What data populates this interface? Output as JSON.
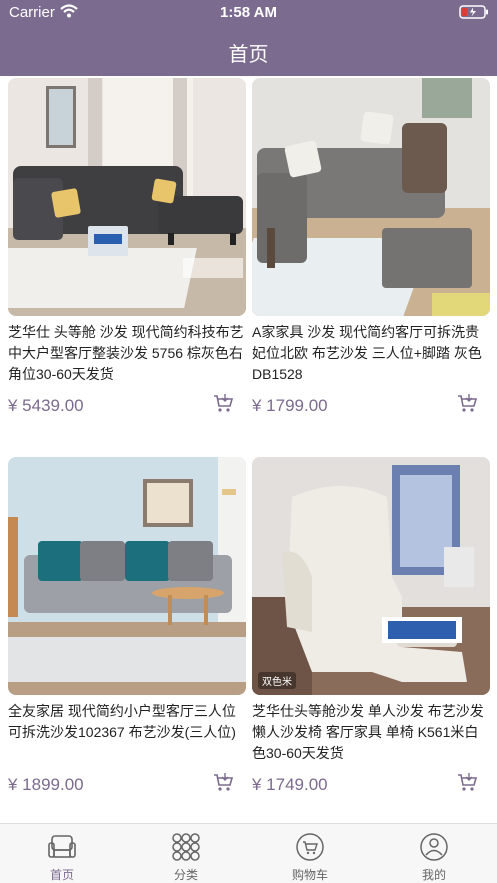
{
  "status_bar": {
    "carrier": "Carrier",
    "time": "1:58 AM"
  },
  "header": {
    "title": "首页"
  },
  "colors": {
    "accent": "#7b6b8f",
    "price": "#7b6b8f",
    "tab_active": "#7b6b8f",
    "tab_inactive": "#666666"
  },
  "products": [
    {
      "name": "芝华仕 头等舱 沙发 现代简约科技布艺中大户型客厅整装沙发 5756 棕灰色右角位30-60天发货",
      "price": "¥ 5439.00",
      "cart_icon": "cart-icon"
    },
    {
      "name": "A家家具 沙发 现代简约客厅可拆洗贵妃位北欧 布艺沙发 三人位+脚踏 灰色 DB1528",
      "price": "¥ 1799.00",
      "cart_icon": "cart-icon"
    },
    {
      "name": "全友家居 现代简约小户型客厅三人位可拆洗沙发102367 布艺沙发(三人位)",
      "price": "¥ 1899.00",
      "cart_icon": "cart-icon"
    },
    {
      "name": "芝华仕头等舱沙发 单人沙发 布艺沙发 懒人沙发椅 客厅家具 单椅 K561米白色30-60天发货",
      "price": "¥ 1749.00",
      "cart_icon": "cart-icon",
      "image_tag": "双色米"
    }
  ],
  "tabs": [
    {
      "label": "首页",
      "icon": "sofa-icon",
      "active": true
    },
    {
      "label": "分类",
      "icon": "grid-icon",
      "active": false
    },
    {
      "label": "购物车",
      "icon": "cart-icon",
      "active": false
    },
    {
      "label": "我的",
      "icon": "user-icon",
      "active": false
    }
  ]
}
